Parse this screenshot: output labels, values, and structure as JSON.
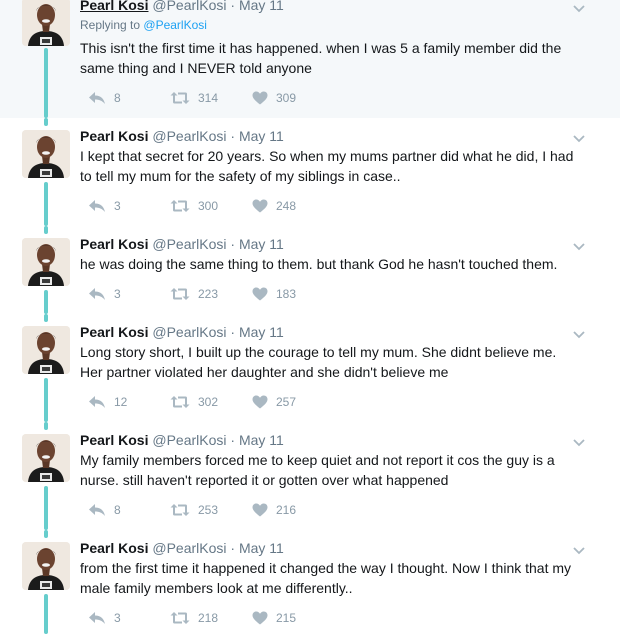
{
  "replying_label": "Replying to",
  "replying_handle": "@PearlKosi",
  "tweets": [
    {
      "name": "Pearl Kosi",
      "handle": "@PearlKosi",
      "dot": "·",
      "date": "May 11",
      "text_lines": [
        "This isn't the first time it has happened. when I was 5 a family member did the",
        "same thing and I NEVER told anyone"
      ],
      "replies": "8",
      "retweets": "314",
      "likes": "309"
    },
    {
      "name": "Pearl Kosi",
      "handle": "@PearlKosi",
      "dot": "·",
      "date": "May 11",
      "text_lines": [
        "I kept that secret for 20 years. So when my mums partner did what he did, I had",
        "to tell my mum for the safety of my siblings in case.."
      ],
      "replies": "3",
      "retweets": "300",
      "likes": "248"
    },
    {
      "name": "Pearl Kosi",
      "handle": "@PearlKosi",
      "dot": "·",
      "date": "May 11",
      "text_lines": [
        "he was doing the same thing to them. but thank God he hasn't touched them."
      ],
      "replies": "3",
      "retweets": "223",
      "likes": "183"
    },
    {
      "name": "Pearl Kosi",
      "handle": "@PearlKosi",
      "dot": "·",
      "date": "May 11",
      "text_lines": [
        "Long story short, I built up the courage to tell my mum. She didnt believe me.",
        "Her partner violated her daughter and she didn't believe me"
      ],
      "replies": "12",
      "retweets": "302",
      "likes": "257"
    },
    {
      "name": "Pearl Kosi",
      "handle": "@PearlKosi",
      "dot": "·",
      "date": "May 11",
      "text_lines": [
        "My family members forced me to keep quiet and not report it cos the guy is a",
        "nurse. still haven't reported it or gotten over what happened"
      ],
      "replies": "8",
      "retweets": "253",
      "likes": "216"
    },
    {
      "name": "Pearl Kosi",
      "handle": "@PearlKosi",
      "dot": "·",
      "date": "May 11",
      "text_lines": [
        "from the first time it happened it changed the way I thought. Now I think that my",
        "male family members look at me differently.."
      ],
      "replies": "3",
      "retweets": "218",
      "likes": "215"
    }
  ],
  "colors": {
    "thread": "#66cdcc",
    "meta": "#657786",
    "action": "#8899a6",
    "link": "#1da1f2",
    "first_bg": "#f5f8fa"
  }
}
